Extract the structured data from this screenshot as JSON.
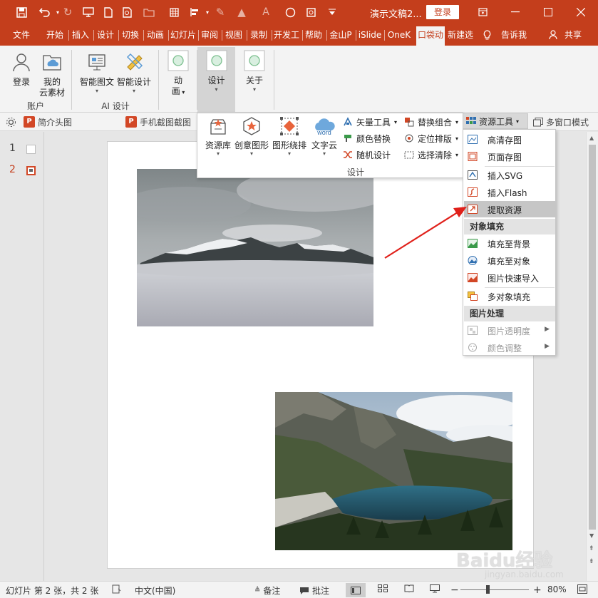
{
  "window": {
    "title": "演示文稿2...",
    "login": "登录",
    "qa_save": "save-icon",
    "qa_undo": "undo-icon",
    "qa_redo": "redo-icon"
  },
  "tabs": [
    "文件",
    "开始",
    "插入",
    "设计",
    "切换",
    "动画",
    "幻灯片",
    "审阅",
    "视图",
    "录制",
    "开发工",
    "帮助",
    "金山P",
    "iSlide",
    "OneK",
    "口袋动",
    "新建选"
  ],
  "tell_me": "告诉我",
  "share": "共享",
  "ribbon": {
    "account": {
      "login": "登录",
      "mine_line1": "我的",
      "mine_line2": "云素材",
      "label": "账户"
    },
    "ai": {
      "smart_graphic": "智能图文",
      "smart_design": "智能设计",
      "label": "AI 设计"
    },
    "anim_line1": "动",
    "anim_line2": "画",
    "design": "设计",
    "about": "关于"
  },
  "toolrow": {
    "item1": "简介头图",
    "item2": "手机截图截图",
    "multiwindow": "多窗口模式"
  },
  "design_panel": {
    "big_buttons": [
      "资源库",
      "创意图形",
      "图形绕排",
      "文字云"
    ],
    "col1": [
      "矢量工具",
      "颜色替换",
      "随机设计"
    ],
    "col2": [
      "替换组合",
      "定位排版",
      "选择清除"
    ],
    "label": "设计",
    "wordcloud_icon_text": "word"
  },
  "res_tool": "资源工具",
  "menu": {
    "items1": [
      "高清存图",
      "页面存图",
      "插入SVG",
      "插入Flash",
      "提取资源"
    ],
    "head1": "对象填充",
    "items2": [
      "填充至背景",
      "填充至对象",
      "图片快速导入",
      "多对象填充"
    ],
    "head2": "图片处理",
    "items3": [
      "图片透明度",
      "颜色调整"
    ]
  },
  "slides": {
    "numbers": [
      "1",
      "2"
    ]
  },
  "status": {
    "slide_info": "幻灯片 第 2 张，共 2 张",
    "language": "中文(中国)",
    "notes": "备注",
    "comments": "批注",
    "zoom": "80%"
  },
  "watermark": {
    "brand": "Baidu经验",
    "url": "jingyan.baidu.com"
  }
}
